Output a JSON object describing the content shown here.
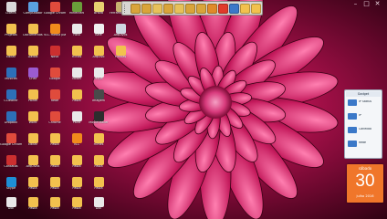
{
  "desktop": {
    "icons": [
      {
        "label": "Lixeira",
        "color": "#d9d9d9"
      },
      {
        "label": "Computador",
        "color": "#5aa0e0"
      },
      {
        "label": "Google Chrome",
        "color": "#e04b3c"
      },
      {
        "label": "Minecraft",
        "color": "#6a9d3a"
      },
      {
        "label": "Brava",
        "color": "#e8d070"
      },
      {
        "label": "Ferramentas de ...",
        "color": "#c8b270"
      },
      {
        "label": "Projetos",
        "color": "#f2c14e"
      },
      {
        "label": "Documentos",
        "color": "#f2c14e"
      },
      {
        "label": "VLC media player",
        "color": "#f08a1c"
      },
      {
        "label": "Foto",
        "color": "#e9e9e9"
      },
      {
        "label": "Kafe",
        "color": "#f0f0f0"
      },
      {
        "label": "Arquivos",
        "color": "#cfd6e0"
      },
      {
        "label": "Editar",
        "color": "#f2c14e"
      },
      {
        "label": "Dados",
        "color": "#f2c14e"
      },
      {
        "label": "Novo",
        "color": "#cc2f2f"
      },
      {
        "label": "Fichas",
        "color": "#f2c14e"
      },
      {
        "label": "Arquivo",
        "color": "#f2c14e"
      },
      {
        "label": "Plantas",
        "color": "#f2c14e"
      },
      {
        "label": "Musicas",
        "color": "#2d6fb8"
      },
      {
        "label": "Criar",
        "color": "#9b5bd0"
      },
      {
        "label": "Google",
        "color": "#e04b3c"
      },
      {
        "label": "Notas",
        "color": "#e9e9e9"
      },
      {
        "label": "Mapa",
        "color": "#e9e9e9"
      },
      {
        "label": "CCleaner",
        "color": "#2d6fb8"
      },
      {
        "label": "Painel",
        "color": "#f2c14e"
      },
      {
        "label": "Rede",
        "color": "#e04b3c"
      },
      {
        "label": "Pasta",
        "color": "#f2c14e"
      },
      {
        "label": "Imagem",
        "color": "#4a4a4a"
      },
      {
        "label": "Dropbox",
        "color": "#2d6fb8"
      },
      {
        "label": "Word",
        "color": "#f2c14e"
      },
      {
        "label": "Chrome",
        "color": "#e04b3c"
      },
      {
        "label": "Paint",
        "color": "#e9e9e9"
      },
      {
        "label": "Movie Maker",
        "color": "#2d2d2d"
      },
      {
        "label": "Google Chrome",
        "color": "#e04b3c"
      },
      {
        "label": "Editar",
        "color": "#f2c14e"
      },
      {
        "label": "Pasta",
        "color": "#f2c14e"
      },
      {
        "label": "VLC",
        "color": "#f08a1c"
      },
      {
        "label": "Filmes",
        "color": "#f2c14e"
      },
      {
        "label": "Contatos",
        "color": "#cc2f2f"
      },
      {
        "label": "Arquivos",
        "color": "#f2c14e"
      },
      {
        "label": "Pasta",
        "color": "#f2c14e"
      },
      {
        "label": "Pasta",
        "color": "#f2c14e"
      },
      {
        "label": "Pasta",
        "color": "#f2c14e"
      },
      {
        "label": "Skype",
        "color": "#1e8fd6"
      },
      {
        "label": "Pasta",
        "color": "#f2c14e"
      },
      {
        "label": "Pasta",
        "color": "#f2c14e"
      },
      {
        "label": "Pasta",
        "color": "#f2c14e"
      },
      {
        "label": "Pasta",
        "color": "#f2c14e"
      },
      {
        "label": "Doc",
        "color": "#e9e9e9"
      },
      {
        "label": "Pasta",
        "color": "#f2c14e"
      },
      {
        "label": "Pasta",
        "color": "#f2c14e"
      },
      {
        "label": "Pasta",
        "color": "#f2c14e"
      },
      {
        "label": "Doc",
        "color": "#e9e9e9"
      }
    ]
  },
  "toolbar": {
    "buttons": [
      {
        "icon": "folder-icon",
        "color": "#d9a43a"
      },
      {
        "icon": "folder-icon",
        "color": "#d9a43a"
      },
      {
        "icon": "document-icon",
        "color": "#e7c15a"
      },
      {
        "icon": "folder-icon",
        "color": "#d9a43a"
      },
      {
        "icon": "calendar-icon",
        "color": "#e7c15a"
      },
      {
        "icon": "shortcut-icon",
        "color": "#d9a43a"
      },
      {
        "icon": "folder-icon",
        "color": "#d9a43a"
      },
      {
        "icon": "battery-icon",
        "color": "#e08a2a"
      },
      {
        "icon": "add-icon",
        "color": "#e03a2a"
      },
      {
        "icon": "window-icon",
        "color": "#3b78c8"
      },
      {
        "icon": "notes-icon",
        "color": "#f2c14e"
      },
      {
        "icon": "edit-icon",
        "color": "#f2c14e"
      }
    ]
  },
  "gadget": {
    "header": "Gadget",
    "rows": [
      {
        "text": "IP Status"
      },
      {
        "text": "IP"
      },
      {
        "text": "Conexão"
      },
      {
        "text": "Rede"
      }
    ]
  },
  "calendar": {
    "weekday": "sábado",
    "day": "30",
    "month_year": "julho 2016"
  },
  "colors": {
    "wallpaper_petal": "#b0124e",
    "wallpaper_dark": "#3a0418",
    "calendar": "#f0762a"
  }
}
